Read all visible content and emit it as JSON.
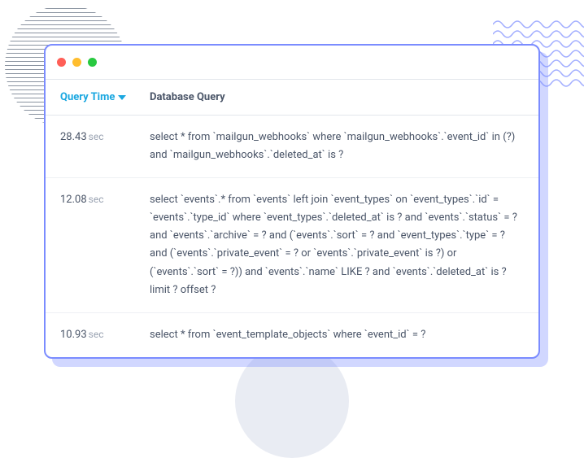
{
  "columns": {
    "time_header": "Query Time",
    "query_header": "Database Query",
    "time_unit": "sec"
  },
  "rows": [
    {
      "time": "28.43",
      "query": "select * from `mailgun_webhooks` where `mailgun_webhooks`.`event_id` in (?) and `mailgun_webhooks`.`deleted_at` is ?"
    },
    {
      "time": "12.08",
      "query": "select `events`.* from `events` left join `event_types` on `event_types`.`id` = `events`.`type_id` where `event_types`.`deleted_at` is ? and `events`.`status` = ? and `events`.`archive` = ? and (`events`.`sort` = ? and `event_types`.`type` = ? and (`events`.`private_event` = ? or `events`.`private_event` is ?) or (`events`.`sort` = ?)) and `events`.`name` LIKE ? and `events`.`deleted_at` is ? limit ? offset ?"
    },
    {
      "time": "10.93",
      "query": "select * from `event_template_objects` where `event_id` = ?"
    }
  ]
}
